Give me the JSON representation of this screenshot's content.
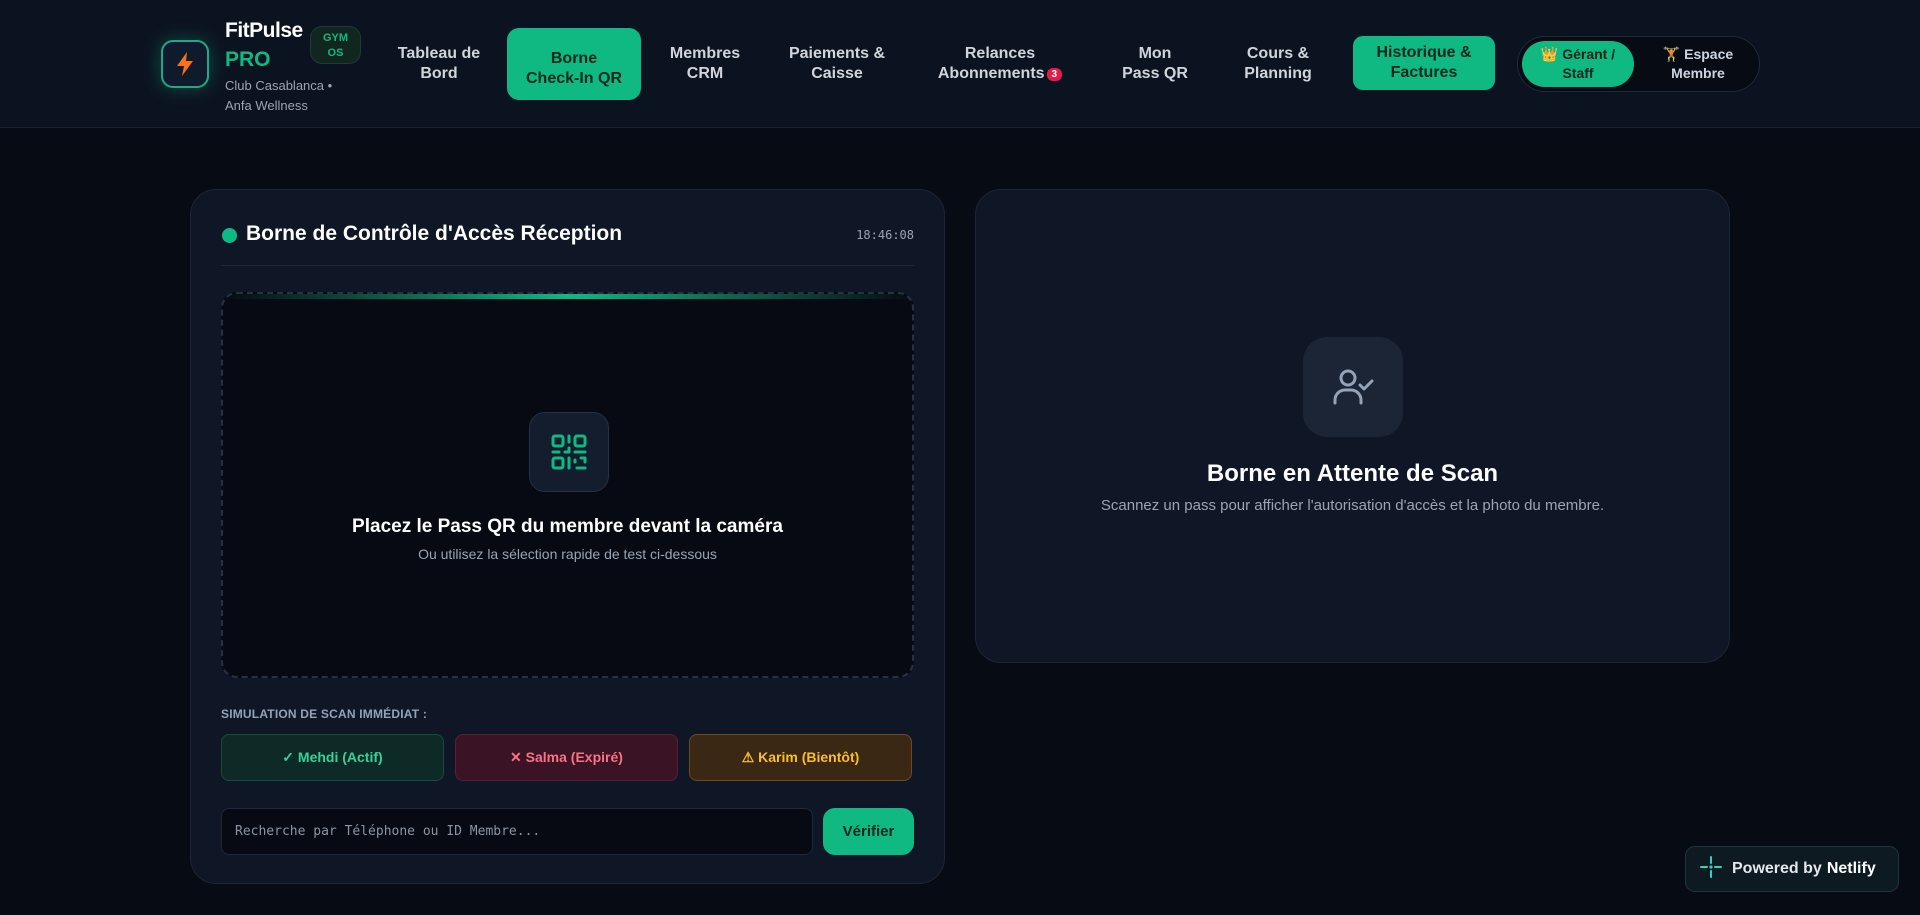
{
  "brand": {
    "name": "FitPulse",
    "tier": "PRO",
    "badge_line1": "GYM",
    "badge_line2": "OS",
    "club_line1": "Club Casablanca •",
    "club_line2": "Anfa Wellness"
  },
  "nav": {
    "items": [
      {
        "line1": "Tableau de",
        "line2": "Bord"
      },
      {
        "line1": "Borne",
        "line2": "Check-In QR"
      },
      {
        "line1": "Membres",
        "line2": "CRM"
      },
      {
        "line1": "Paiements &",
        "line2": "Caisse"
      },
      {
        "line1": "Relances",
        "line2": "Abonnements",
        "badge": "3"
      },
      {
        "line1": "Mon",
        "line2": "Pass QR"
      },
      {
        "line1": "Cours &",
        "line2": "Planning"
      },
      {
        "line1": "Historique &",
        "line2": "Factures"
      }
    ],
    "active_index": 1
  },
  "roles": {
    "staff_line1": "👑 Gérant /",
    "staff_line2": "Staff",
    "member_line1": "🏋 Espace",
    "member_line2": "Membre"
  },
  "kiosk": {
    "title": "Borne de Contrôle d'Accès Réception",
    "clock": "18:46:08",
    "scan_title": "Placez le Pass QR du membre devant la caméra",
    "scan_subtitle": "Ou utilisez la sélection rapide de test ci-dessous",
    "simulation_label": "SIMULATION DE SCAN IMMÉDIAT :",
    "sim_buttons": {
      "active": "✓ Mehdi (Actif)",
      "expired": "✕ Salma (Expiré)",
      "soon": "⚠ Karim (Bientôt)"
    },
    "search_placeholder": "Recherche par Téléphone ou ID Membre...",
    "verify_label": "Vérifier"
  },
  "result": {
    "title": "Borne en Attente de Scan",
    "subtitle": "Scannez un pass pour afficher l'autorisation d'accès et la photo du membre."
  },
  "footer": {
    "powered_prefix": "Powered by",
    "powered_brand": "Netlify"
  },
  "colors": {
    "accent": "#10b981",
    "background": "#070b14",
    "card": "#0f1626",
    "danger": "#fb7185",
    "warning": "#fbbf24"
  },
  "icons": {
    "logo": "lightning-bolt-icon",
    "qr": "qr-code-icon",
    "avatar": "user-check-icon",
    "netlify": "netlify-icon"
  }
}
